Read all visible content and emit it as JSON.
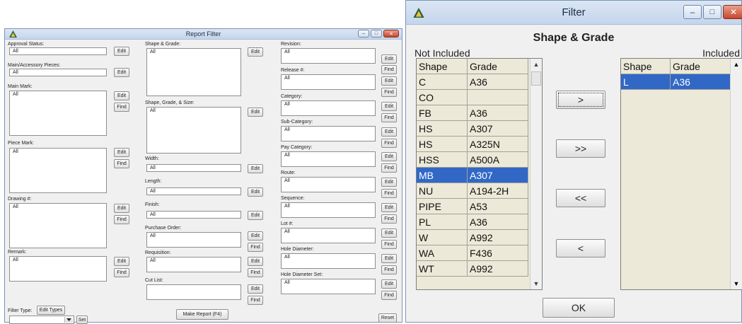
{
  "report_filter": {
    "title": "Report Filter",
    "edit": "Edit",
    "find": "Find",
    "all": "All",
    "col1": {
      "approval_status": "Approval Status:",
      "main_accessory": "Main/Accessory Pieces:",
      "main_mark": "Main Mark:",
      "piece_mark": "Piece Mark:",
      "drawing": "Drawing #:",
      "remark": "Remark:",
      "filter_type": "Filter Type:",
      "edit_types": "Edit Types",
      "set": "Set"
    },
    "col2": {
      "shape_grade": "Shape & Grade:",
      "shape_grade_size": "Shape, Grade, & Size:",
      "width": "Width:",
      "length": "Length:",
      "finish": "Finish:",
      "purchase_order": "Purchase Order:",
      "requisition": "Requisition:",
      "cut_list": "Cut List:",
      "make_report": "Make Report (F4)"
    },
    "col3": {
      "revision": "Revision:",
      "release": "Release #:",
      "category": "Category:",
      "sub_category": "Sub-Category:",
      "pay_category": "Pay Category:",
      "route": "Route:",
      "sequence": "Sequence:",
      "lot": "Lot #:",
      "hole_diameter": "Hole Diameter:",
      "hole_diameter_set": "Hole Diameter Set:",
      "reset": "Reset"
    }
  },
  "filter_dialog": {
    "title": "Filter",
    "heading": "Shape & Grade",
    "not_included": "Not Included",
    "included": "Included",
    "col_shape": "Shape",
    "col_grade": "Grade",
    "not_included_rows": [
      {
        "shape": "C",
        "grade": "A36"
      },
      {
        "shape": "CO",
        "grade": ""
      },
      {
        "shape": "FB",
        "grade": "A36"
      },
      {
        "shape": "HS",
        "grade": "A307"
      },
      {
        "shape": "HS",
        "grade": "A325N"
      },
      {
        "shape": "HSS",
        "grade": "A500A"
      },
      {
        "shape": "MB",
        "grade": "A307"
      },
      {
        "shape": "NU",
        "grade": "A194-2H"
      },
      {
        "shape": "PIPE",
        "grade": "A53"
      },
      {
        "shape": "PL",
        "grade": "A36"
      },
      {
        "shape": "W",
        "grade": "A992"
      },
      {
        "shape": "WA",
        "grade": "F436"
      },
      {
        "shape": "WT",
        "grade": "A992"
      }
    ],
    "selected_not_included_index": 6,
    "included_rows": [
      {
        "shape": "L",
        "grade": "A36"
      }
    ],
    "btn_add": ">",
    "btn_add_all": ">>",
    "btn_remove_all": "<<",
    "btn_remove": "<",
    "ok": "OK"
  },
  "colors": {
    "selection": "#3168c6",
    "grid_bg": "#ece9d8",
    "titlebar": "#c4d5ec"
  }
}
